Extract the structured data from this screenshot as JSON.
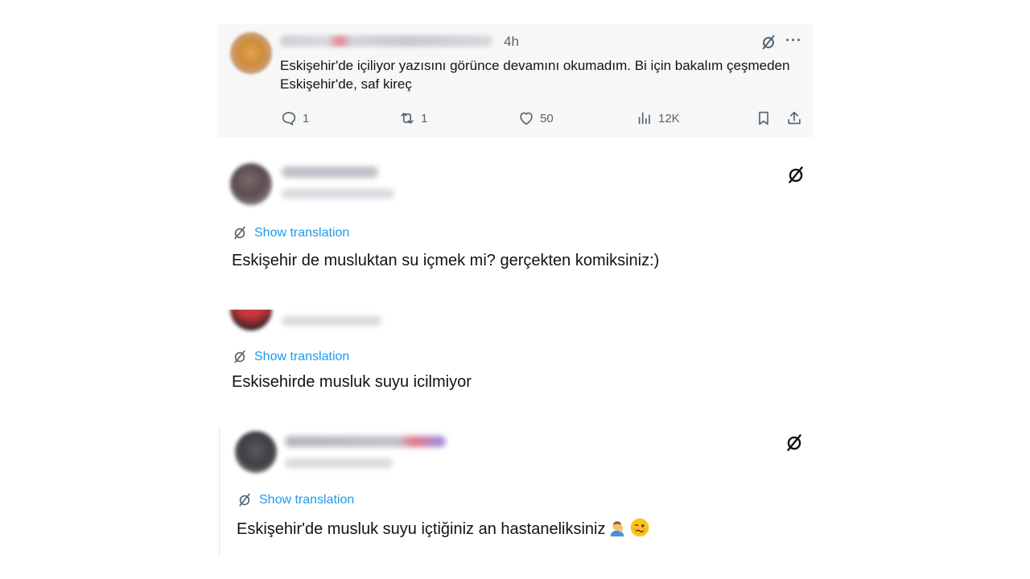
{
  "tweet": {
    "time": "4h",
    "text": "Eskişehir'de içiliyor yazısını görünce devamını okumadım. Bi için bakalım çeşmeden Eskişehir'de, saf kireç",
    "more_label": "···",
    "replies": "1",
    "retweets": "1",
    "likes": "50",
    "views": "12K"
  },
  "replies": [
    {
      "translation_label": "Show translation",
      "text": "Eskişehir de musluktan su içmek mi? gerçekten komiksiniz:)"
    },
    {
      "translation_label": "Show translation",
      "text": "Eskisehirde musluk suyu icilmiyor"
    },
    {
      "translation_label": "Show translation",
      "text": "Eskişehir'de musluk suyu içtiğiniz an hastaneliksiniz"
    }
  ],
  "colors": {
    "link": "#1d9bf0",
    "secondary_text": "#536471",
    "primary_text": "#0f1419",
    "card_background": "#f7f7f7"
  },
  "icons": [
    "grok-icon",
    "more-icon",
    "reply-icon",
    "retweet-icon",
    "like-icon",
    "views-icon",
    "bookmark-icon",
    "share-icon",
    "translate-icon",
    "facepalm-emoji",
    "woozy-face-emoji"
  ]
}
